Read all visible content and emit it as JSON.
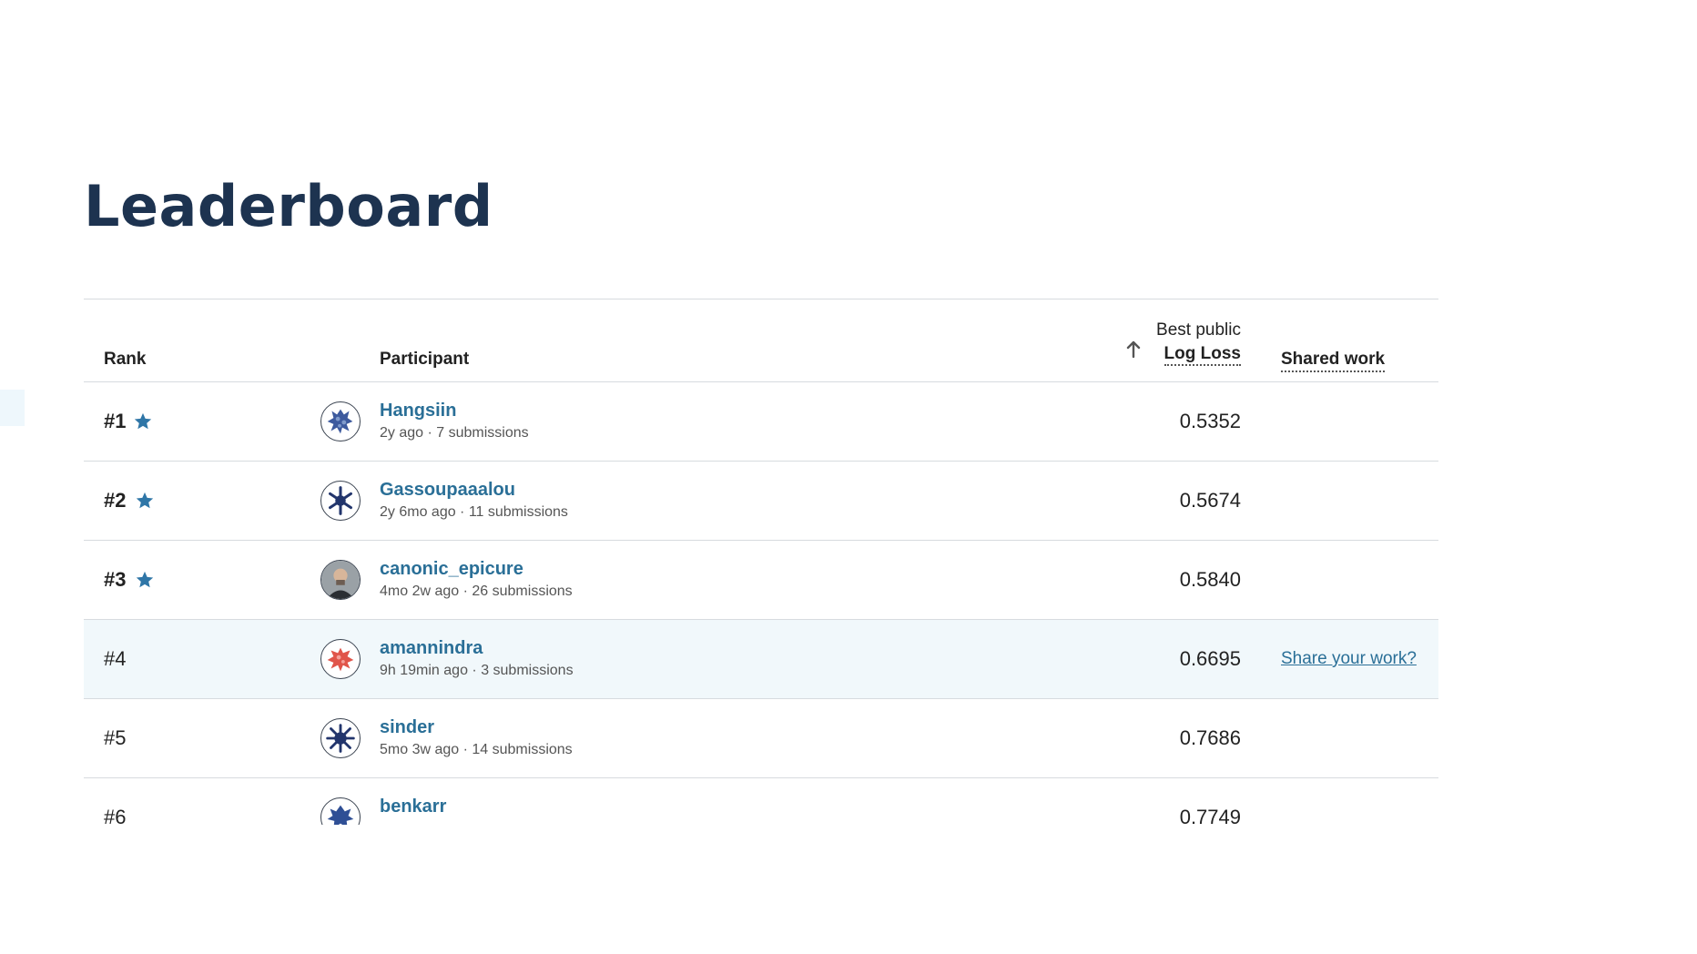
{
  "page": {
    "title": "Leaderboard"
  },
  "table": {
    "headers": {
      "rank": "Rank",
      "participant": "Participant",
      "best_public": "Best public",
      "metric": "Log Loss",
      "shared_work": "Shared work"
    },
    "rows": [
      {
        "rank": "#1",
        "starred": true,
        "name": "Hangsiin",
        "time": "2y ago",
        "submissions": "7 submissions",
        "score": "0.5352",
        "share": ""
      },
      {
        "rank": "#2",
        "starred": true,
        "name": "Gassoupaaalou",
        "time": "2y 6mo ago",
        "submissions": "11 submissions",
        "score": "0.5674",
        "share": ""
      },
      {
        "rank": "#3",
        "starred": true,
        "name": "canonic_epicure",
        "time": "4mo 2w ago",
        "submissions": "26 submissions",
        "score": "0.5840",
        "share": ""
      },
      {
        "rank": "#4",
        "starred": false,
        "name": "amannindra",
        "time": "9h 19min ago",
        "submissions": "3 submissions",
        "score": "0.6695",
        "share": "Share your work?"
      },
      {
        "rank": "#5",
        "starred": false,
        "name": "sinder",
        "time": "5mo 3w ago",
        "submissions": "14 submissions",
        "score": "0.7686",
        "share": ""
      },
      {
        "rank": "#6",
        "starred": false,
        "name": "benkarr",
        "time": "",
        "submissions": "",
        "score": "0.7749",
        "share": ""
      }
    ]
  },
  "colors": {
    "accent": "#2a6f97",
    "title": "#1d3350",
    "highlight_row": "#f1f8fb",
    "star": "#2f76a7"
  },
  "icons": {
    "star": "star-icon",
    "sort": "arrow-up-icon",
    "avatar": "avatar-icon"
  }
}
